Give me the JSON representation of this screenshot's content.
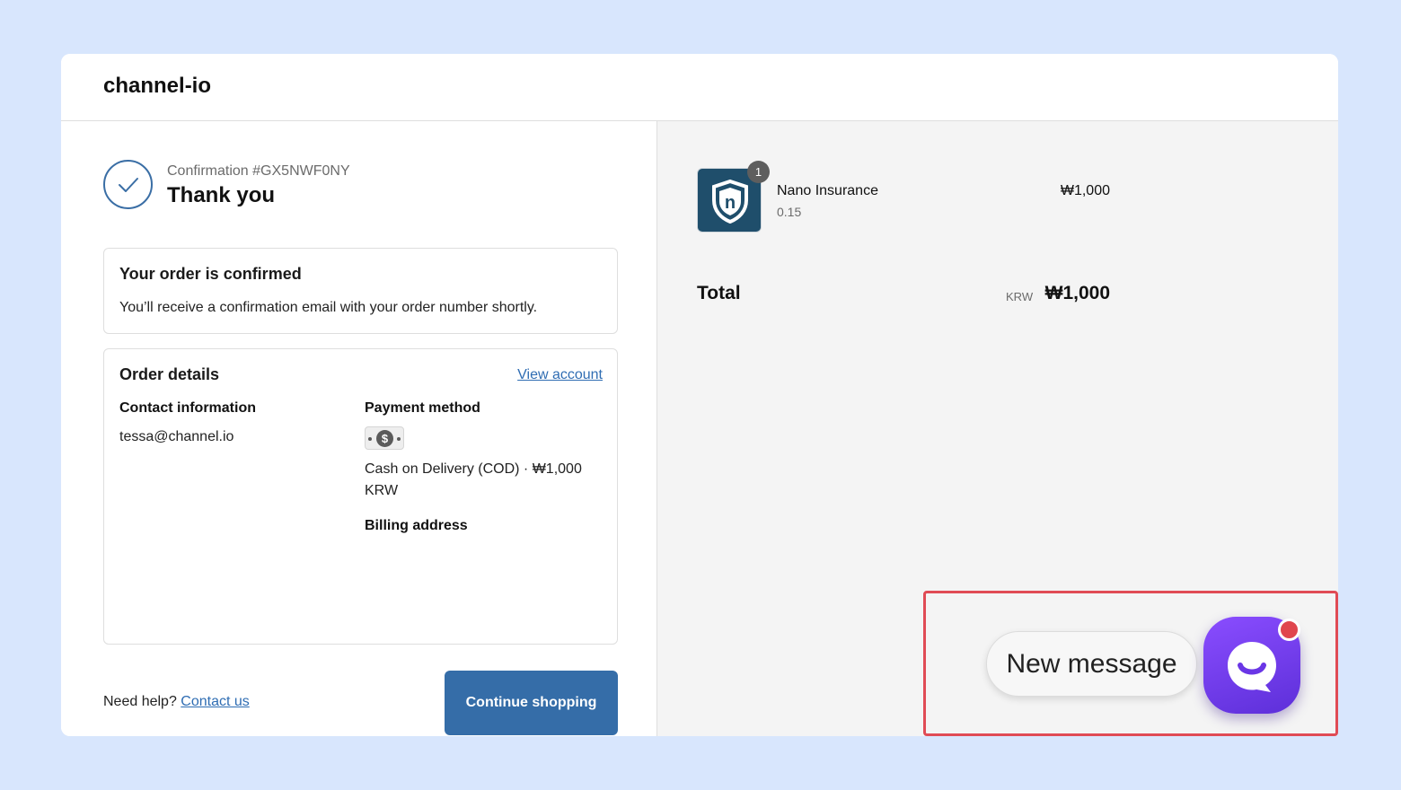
{
  "header": {
    "shop_name": "channel-io"
  },
  "confirmation": {
    "number": "Confirmation #GX5NWF0NY",
    "title": "Thank you"
  },
  "confirmed_box": {
    "heading": "Your order is confirmed",
    "message": "You’ll receive a confirmation email with your order number shortly."
  },
  "order_details": {
    "heading": "Order details",
    "view_account": "View account",
    "contact_label": "Contact information",
    "contact_email": "tessa@channel.io",
    "payment_label": "Payment method",
    "payment_line1": "Cash on Delivery (COD) · ₩1,000",
    "payment_line2": "KRW",
    "billing_label": "Billing address"
  },
  "footer": {
    "help_text": "Need help?",
    "contact_link": "Contact us",
    "continue_button": "Continue shopping"
  },
  "summary": {
    "product": {
      "name": "Nano Insurance",
      "variant": "0.15",
      "price": "₩1,000",
      "quantity": "1",
      "thumb_letter": "n"
    },
    "total_label": "Total",
    "total_currency": "KRW",
    "total_value": "₩1,000"
  },
  "chat": {
    "bubble_text": "New message"
  },
  "colors": {
    "accent": "#356da8",
    "link": "#2f6db3",
    "chat": "#7a42f4",
    "highlight": "#e04b55",
    "background": "#d8e6fd"
  },
  "icons": {
    "check": "check-icon",
    "cash": "cash-icon",
    "shield": "shield-logo-icon",
    "chat": "chat-smile-icon"
  }
}
